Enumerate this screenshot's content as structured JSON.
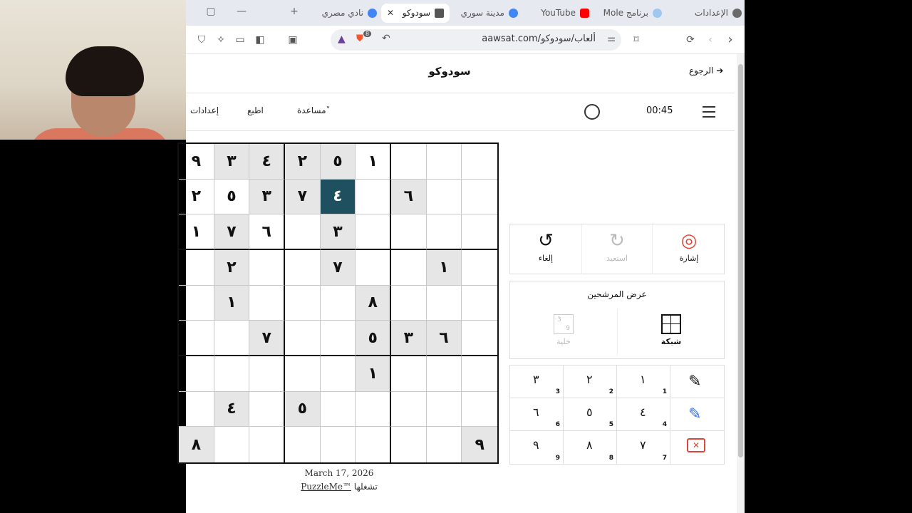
{
  "tabs": [
    {
      "label": "الإعدادات",
      "fav_color": "#6a6a6a"
    },
    {
      "label": "برنامج Mole",
      "fav_color": "#9fc8f0"
    },
    {
      "label": "YouTube",
      "fav_color": "#ff0000"
    },
    {
      "label": "مدينة سوري",
      "fav_color": "#4285f4"
    },
    {
      "label": "سودوكو",
      "fav_color": "#555555"
    },
    {
      "label": "نادي مصري",
      "fav_color": "#4285f4"
    }
  ],
  "url": "aawsat.com/ألعاب/سودوكو",
  "page": {
    "title": "سودوكو",
    "back_label": "الرجوع",
    "menu": {
      "settings": "إعدادات",
      "print": "اطبع",
      "help": "مساعدة˅"
    },
    "timer": "00:45"
  },
  "grid": [
    [
      "٩",
      "٣",
      "٤",
      "٢",
      "٥",
      "١",
      "",
      "",
      ""
    ],
    [
      "٢",
      "٥",
      "٣",
      "٧",
      "٤",
      "",
      "٦",
      "",
      ""
    ],
    [
      "١",
      "٧",
      "٦",
      "",
      "٣",
      "",
      "",
      "",
      ""
    ],
    [
      "",
      "٢",
      "",
      "",
      "٧",
      "",
      "",
      "١",
      ""
    ],
    [
      "",
      "١",
      "",
      "",
      "",
      "٨",
      "",
      "",
      ""
    ],
    [
      "",
      "",
      "٧",
      "",
      "",
      "٥",
      "٣",
      "٦",
      ""
    ],
    [
      "",
      "",
      "",
      "",
      "",
      "١",
      "",
      "",
      ""
    ],
    [
      "",
      "٤",
      "",
      "٥",
      "",
      "",
      "",
      "",
      ""
    ],
    [
      "٨",
      "",
      "",
      "",
      "",
      "",
      "",
      "",
      "٩"
    ]
  ],
  "given": [
    [
      0,
      1,
      1,
      1,
      1,
      0,
      0,
      0,
      0
    ],
    [
      0,
      0,
      1,
      1,
      2,
      0,
      1,
      0,
      0
    ],
    [
      0,
      1,
      0,
      0,
      1,
      0,
      0,
      0,
      0
    ],
    [
      0,
      1,
      0,
      0,
      1,
      0,
      0,
      1,
      0
    ],
    [
      0,
      1,
      0,
      0,
      0,
      1,
      0,
      0,
      0
    ],
    [
      0,
      0,
      1,
      0,
      0,
      1,
      1,
      1,
      0
    ],
    [
      0,
      0,
      0,
      0,
      0,
      1,
      0,
      0,
      0
    ],
    [
      0,
      1,
      0,
      1,
      0,
      0,
      0,
      0,
      0
    ],
    [
      1,
      0,
      0,
      0,
      0,
      0,
      0,
      0,
      1
    ]
  ],
  "footer": {
    "date": "March 17, 2026",
    "powered_link": "PuzzleMe™",
    "powered_text": "تشغلها"
  },
  "actions": {
    "hint": "إشارة",
    "redo": "استعيد",
    "undo": "إلغاء"
  },
  "candidates": {
    "title": "عرض المرشحين",
    "grid": "شبكة",
    "cell": "خلية",
    "cell_icon_top": "3",
    "cell_icon_bottom": "9"
  },
  "numpad": [
    {
      "digit": "١",
      "sub": "1"
    },
    {
      "digit": "٢",
      "sub": "2"
    },
    {
      "digit": "٣",
      "sub": "3"
    },
    {
      "digit": "٤",
      "sub": "4"
    },
    {
      "digit": "٥",
      "sub": "5"
    },
    {
      "digit": "٦",
      "sub": "6"
    },
    {
      "digit": "٧",
      "sub": "7"
    },
    {
      "digit": "٨",
      "sub": "8"
    },
    {
      "digit": "٩",
      "sub": "9"
    }
  ],
  "colors": {
    "selected_cell": "#1f5060",
    "given_cell": "#e6e6e6",
    "delete": "#e0453a",
    "pencil_blue": "#3a6fd8",
    "hint_red": "#e0453a"
  }
}
